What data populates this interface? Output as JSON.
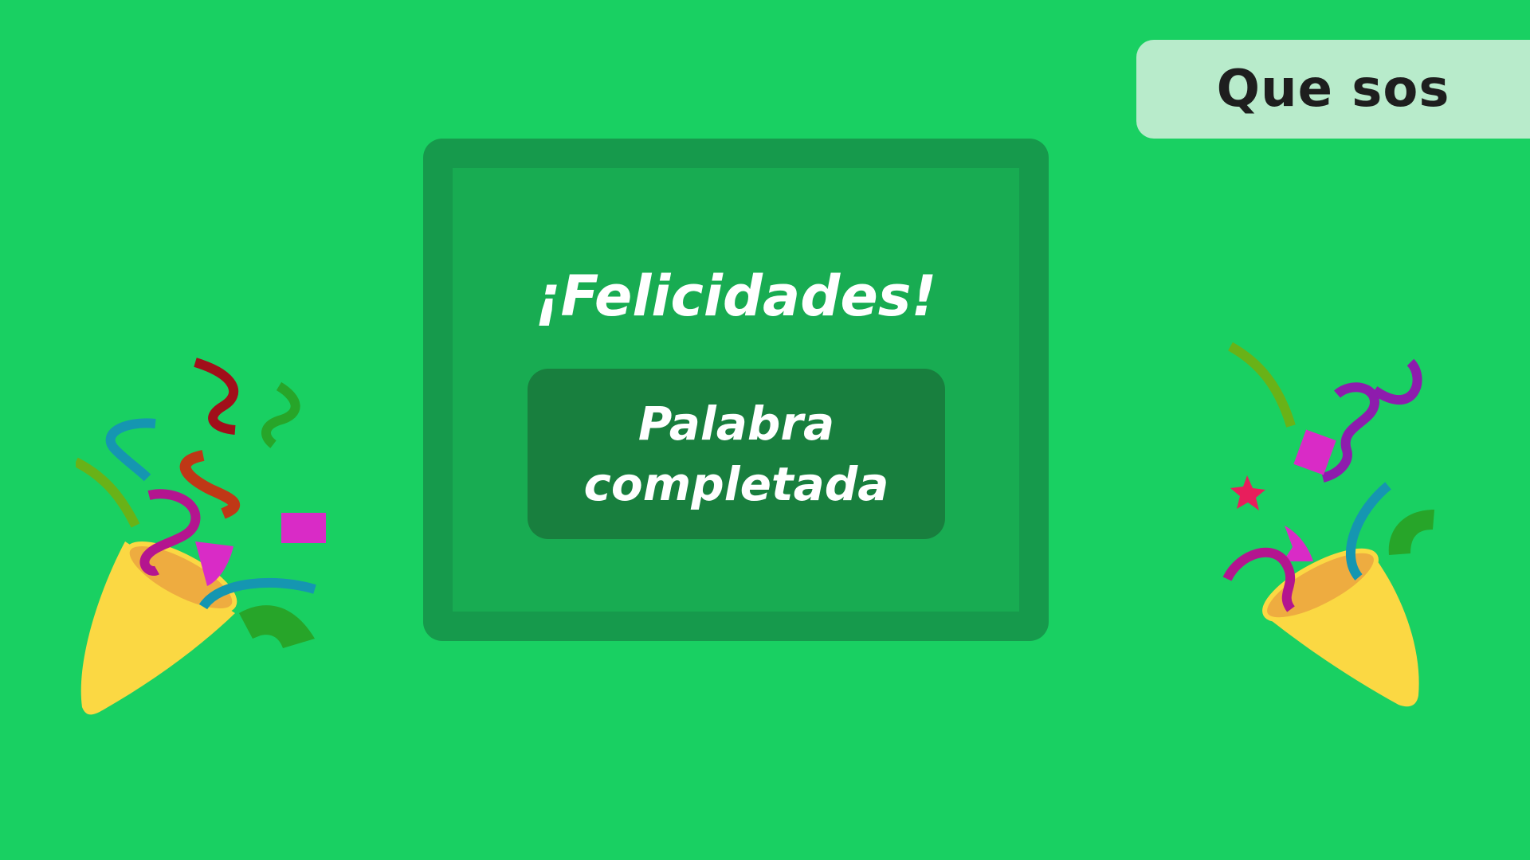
{
  "word_badge": {
    "text": "Que sos"
  },
  "dialog": {
    "title": "¡Felicidades!",
    "message": "Palabra completada"
  },
  "decorations": {
    "left": "party-popper-icon",
    "right": "party-popper-icon"
  },
  "colors": {
    "background": "#19d062",
    "badge": "#b8ebcb",
    "panel_frame": "#169a4c",
    "panel_fill": "#18ac52",
    "message_box": "#187f3e",
    "text": "#ffffff"
  }
}
